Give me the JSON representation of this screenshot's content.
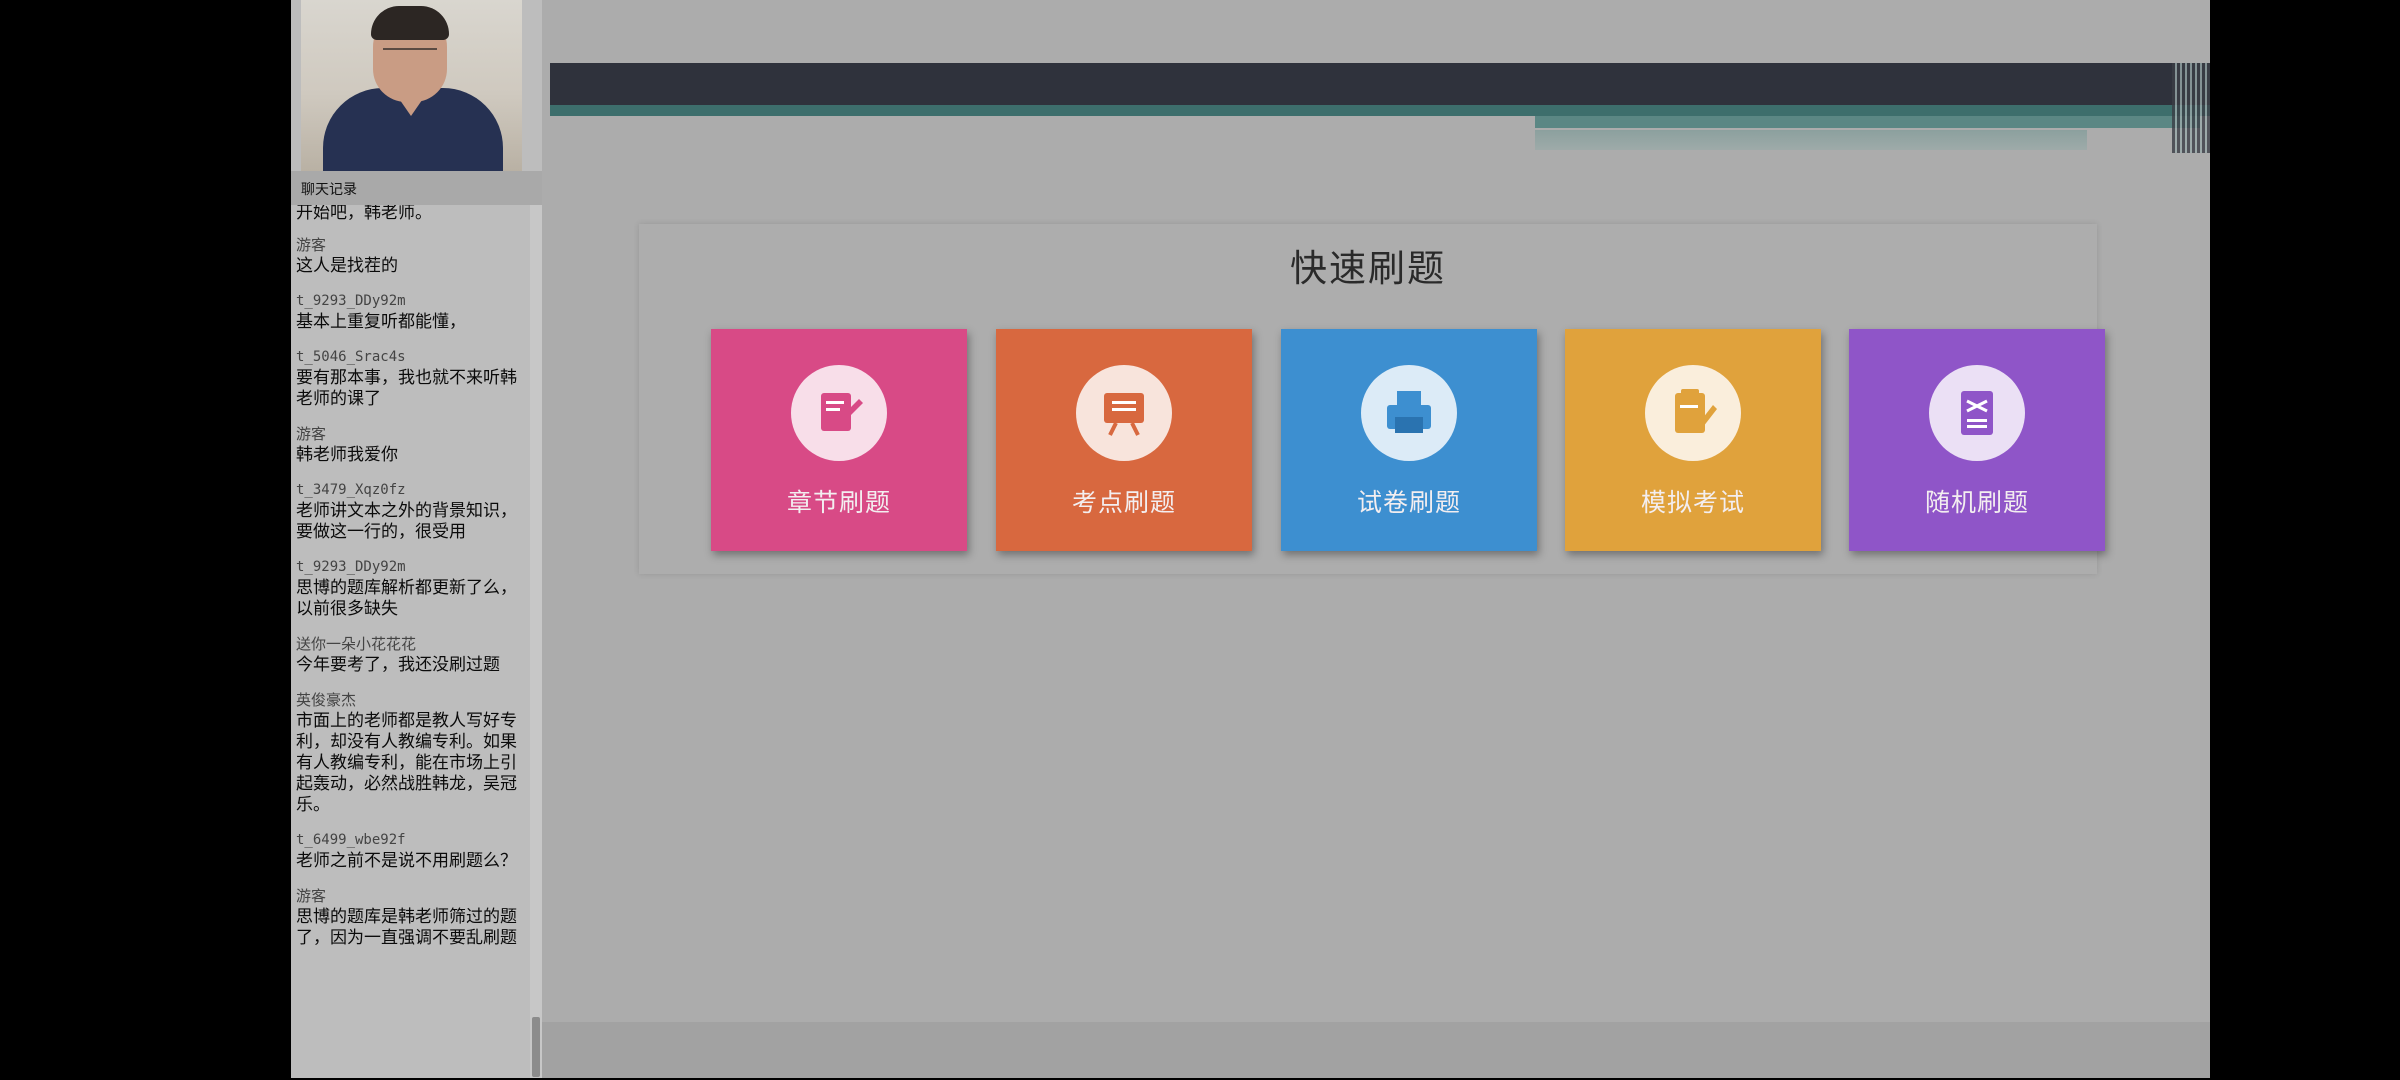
{
  "chat": {
    "header": "聊天记录",
    "first_partial": "开始吧，韩老师。",
    "messages": [
      {
        "user": "游客",
        "text": "这人是找茬的",
        "mono": false
      },
      {
        "user": "t_9293_DDy92m",
        "text": "基本上重复听都能懂，",
        "mono": true
      },
      {
        "user": "t_5046_Srac4s",
        "text": "要有那本事，我也就不来听韩老师的课了",
        "mono": true
      },
      {
        "user": "游客",
        "text": "韩老师我爱你",
        "mono": false
      },
      {
        "user": "t_3479_Xqz0fz",
        "text": "老师讲文本之外的背景知识，要做这一行的，很受用",
        "mono": true
      },
      {
        "user": "t_9293_DDy92m",
        "text": "思博的题库解析都更新了么，以前很多缺失",
        "mono": true
      },
      {
        "user": "送你一朵小花花花",
        "text": "今年要考了，我还没刷过题",
        "mono": false
      },
      {
        "user": "英俊豪杰",
        "text": "市面上的老师都是教人写好专利，却没有人教编专利。如果有人教编专利，能在市场上引起轰动，必然战胜韩龙，吴冠乐。",
        "mono": false
      },
      {
        "user": "t_6499_wbe92f",
        "text": "老师之前不是说不用刷题么？",
        "mono": true
      },
      {
        "user": "游客",
        "text": "思博的题库是韩老师筛过的题了，因为一直强调不要乱刷题",
        "mono": false
      }
    ]
  },
  "main": {
    "section_title": "快速刷题",
    "cards": [
      {
        "label": "章节刷题",
        "icon": "edit-document-icon",
        "color": "#d84a86"
      },
      {
        "label": "考点刷题",
        "icon": "presentation-board-icon",
        "color": "#d8683f"
      },
      {
        "label": "试卷刷题",
        "icon": "printer-icon",
        "color": "#3d8fd0"
      },
      {
        "label": "模拟考试",
        "icon": "clipboard-pen-icon",
        "color": "#e0a23c"
      },
      {
        "label": "随机刷题",
        "icon": "shuffle-document-icon",
        "color": "#8f55c8"
      }
    ]
  }
}
